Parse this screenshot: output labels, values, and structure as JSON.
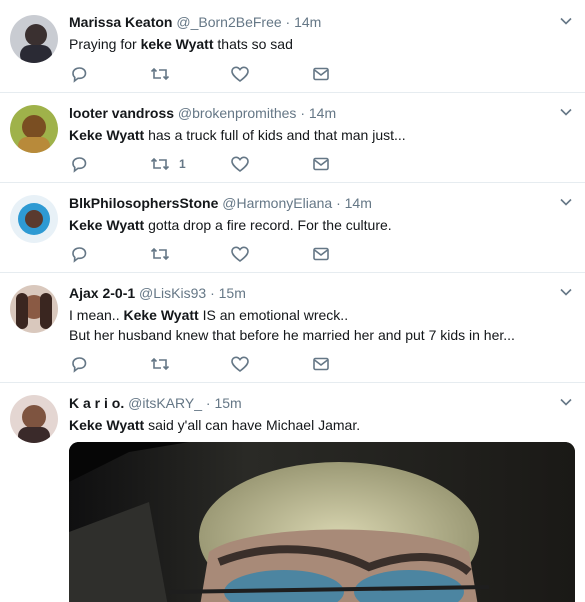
{
  "tweets": [
    {
      "name": "Marissa Keaton",
      "handle": "@_Born2BeFree",
      "dot": "·",
      "time": "14m",
      "parts": [
        "Praying for ",
        "keke Wyatt",
        " thats so sad"
      ],
      "retweets": "",
      "avatar_color": "#3a3a44"
    },
    {
      "name": "looter vandross",
      "handle": "@brokenpromithes",
      "dot": "·",
      "time": "14m",
      "parts": [
        "Keke Wyatt",
        " has a truck full of kids and that man just..."
      ],
      "retweets": "1",
      "avatar_color": "#a87a3a"
    },
    {
      "name": "BlkPhilosophersStone",
      "handle": "@HarmonyEliana",
      "dot": "·",
      "time": "14m",
      "parts": [
        "Keke Wyatt",
        " gotta drop a fire record. For the culture."
      ],
      "retweets": "",
      "avatar_color": "#3aa7d6"
    },
    {
      "name": "Ajax 2-0-1",
      "handle": "@LisKis93",
      "dot": "·",
      "time": "15m",
      "parts": [
        "I mean.. ",
        "Keke Wyatt",
        " IS an emotional wreck.."
      ],
      "line2": "But her husband knew that before he married her and put 7 kids in her...",
      "retweets": "",
      "avatar_color": "#6b4a3a"
    },
    {
      "name": "K a r i o.",
      "handle": "@itsKARY_",
      "dot": "·",
      "time": "15m",
      "parts": [
        "Keke Wyatt",
        " said y'all can have Michael Jamar."
      ],
      "retweets": "",
      "avatar_color": "#5a3a3a"
    }
  ],
  "colors": {
    "icon": "#657786",
    "divider": "#e6ecf0",
    "name": "#14171a"
  },
  "icons": [
    "reply-icon",
    "retweet-icon",
    "like-icon",
    "message-icon",
    "chevron-down-icon"
  ]
}
